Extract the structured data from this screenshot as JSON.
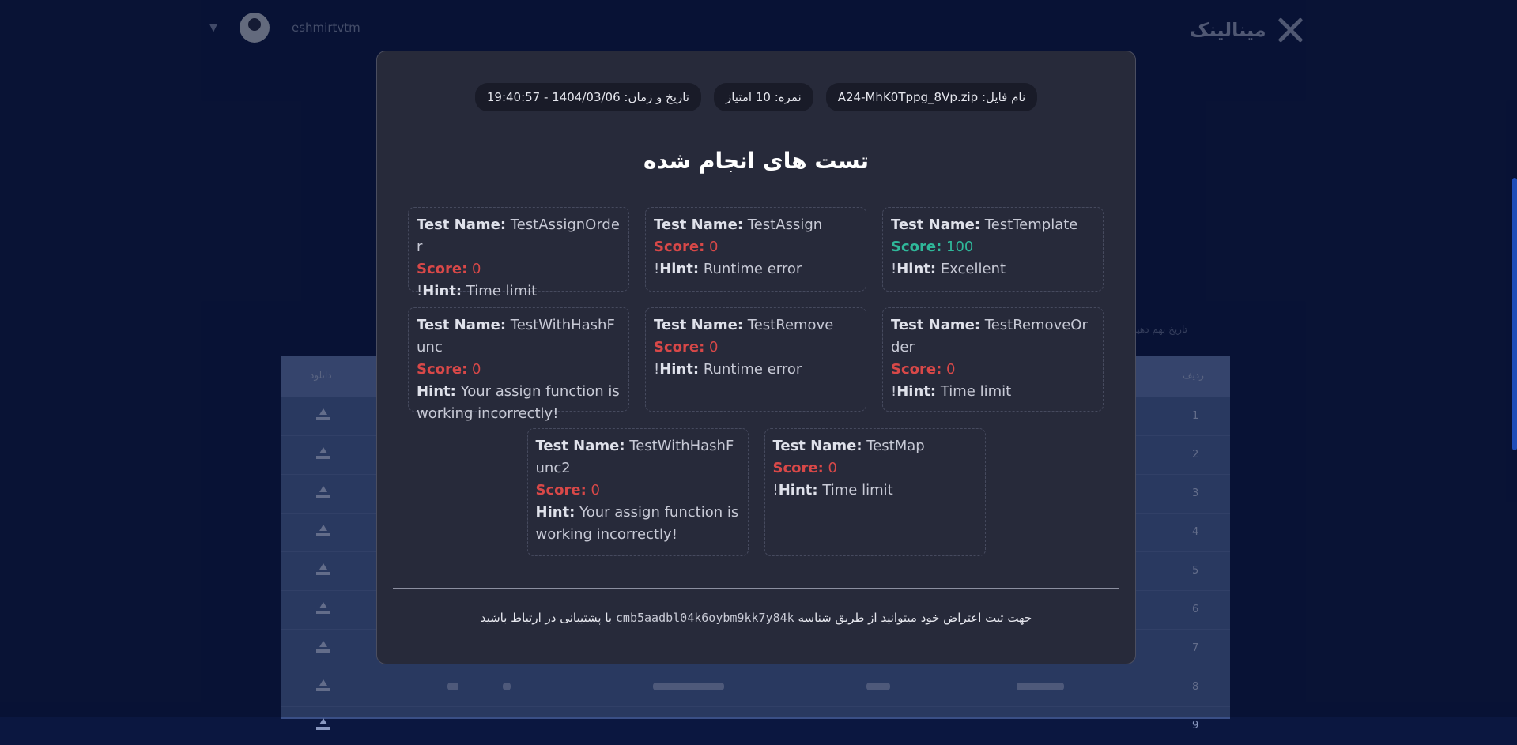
{
  "background": {
    "logo_text": "مینالینک",
    "username": "eshmirtvtm",
    "caption": "تاریخ بهم دهید",
    "table_header_left": "دانلود",
    "table_header_right": "ردیف",
    "row_numbers": [
      "1",
      "2",
      "3",
      "4",
      "5",
      "6",
      "7",
      "8",
      "9"
    ]
  },
  "modal": {
    "file_label": "نام فایل:",
    "file_name": "A24-MhK0Tppg_8Vp.zip",
    "score_label": "نمره:",
    "score_value": "10 امتیاز",
    "datetime_label": "تاریخ و زمان:",
    "datetime_value": "19:40:57 - 1404/03/06",
    "title": "تست های انجام شده",
    "name_key": "Test Name:",
    "score_key": "Score:",
    "hint_key": "Hint:",
    "tests": [
      {
        "name": "TestTemplate",
        "score": "100",
        "hint": "Excellent",
        "pass": true
      },
      {
        "name": "TestAssign",
        "score": "0",
        "hint": "Runtime error",
        "pass": false
      },
      {
        "name": "TestAssignOrder",
        "score": "0",
        "hint": "Time limit",
        "pass": false
      },
      {
        "name": "TestRemoveOrder",
        "score": "0",
        "hint": "Time limit",
        "pass": false
      },
      {
        "name": "TestRemove",
        "score": "0",
        "hint": "Runtime error",
        "pass": false
      },
      {
        "name": "TestWithHashFunc",
        "score": "0",
        "hint": "Your assign function is working incorrectly",
        "pass": false
      },
      {
        "name": "TestMap",
        "score": "0",
        "hint": "Time limit",
        "pass": false
      },
      {
        "name": "TestWithHashFunc2",
        "score": "0",
        "hint": "Your assign function is working incorrectly",
        "pass": false
      }
    ],
    "footer_before": "جهت ثبت اعتراض خود میتوانید از طریق شناسه",
    "footer_code": "cmb5aadbl04k6oybm9kk7y84k",
    "footer_after": "با پشتیبانی در ارتباط باشید"
  },
  "colors": {
    "pass": "#2fb89a",
    "fail": "#d84848",
    "modal_bg": "#272a3a",
    "page_bg": "#0c1a4a"
  }
}
